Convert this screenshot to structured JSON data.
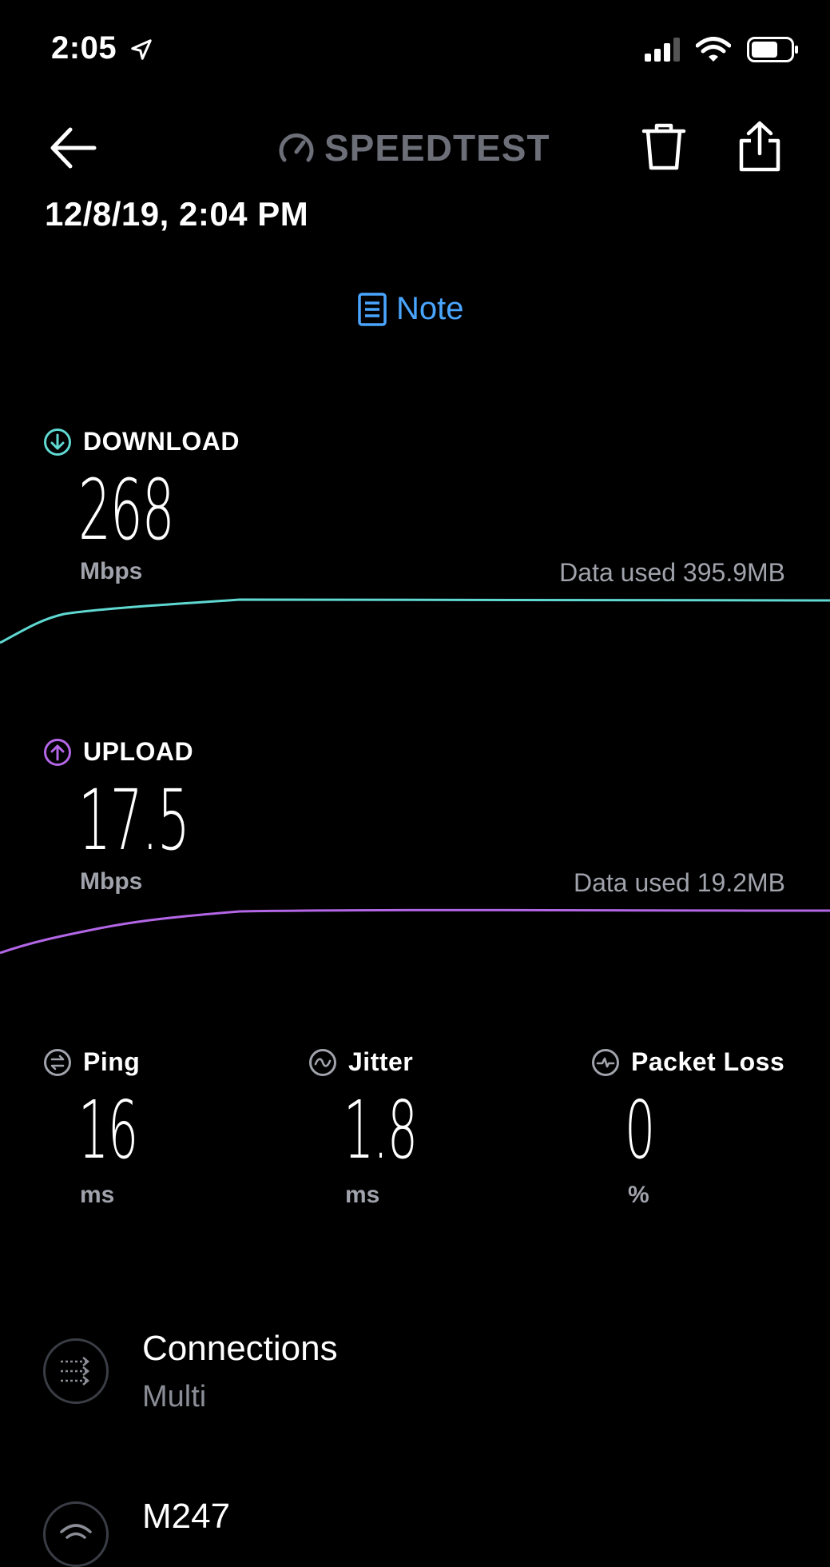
{
  "status_bar": {
    "time": "2:05"
  },
  "header": {
    "logo_text": "SPEEDTEST"
  },
  "date": "12/8/19, 2:04 PM",
  "note": {
    "label": "Note"
  },
  "download": {
    "label": "DOWNLOAD",
    "value": "268",
    "unit": "Mbps",
    "data_used": "Data used 395.9MB",
    "line_color": "#5fd9d2"
  },
  "upload": {
    "label": "UPLOAD",
    "value": "17.5",
    "unit": "Mbps",
    "data_used": "Data used 19.2MB",
    "line_color": "#b366e6"
  },
  "ping": {
    "label": "Ping",
    "value": "16",
    "unit": "ms"
  },
  "jitter": {
    "label": "Jitter",
    "value": "1.8",
    "unit": "ms"
  },
  "packet_loss": {
    "label": "Packet Loss",
    "value": "0",
    "unit": "%"
  },
  "connections": {
    "title": "Connections",
    "value": "Multi"
  },
  "server": {
    "title": "M247"
  },
  "colors": {
    "accent_blue": "#4aa5ff",
    "download": "#5fd9d2",
    "upload": "#b366e6",
    "muted": "#a0a3ab"
  },
  "icons": [
    "location-arrow-icon",
    "cellular-signal-icon",
    "wifi-icon",
    "battery-icon",
    "back-arrow-icon",
    "speedometer-icon",
    "trash-icon",
    "share-icon",
    "note-icon",
    "download-icon",
    "upload-icon",
    "ping-icon",
    "jitter-icon",
    "packet-loss-icon",
    "connections-icon",
    "wifi-server-icon"
  ]
}
